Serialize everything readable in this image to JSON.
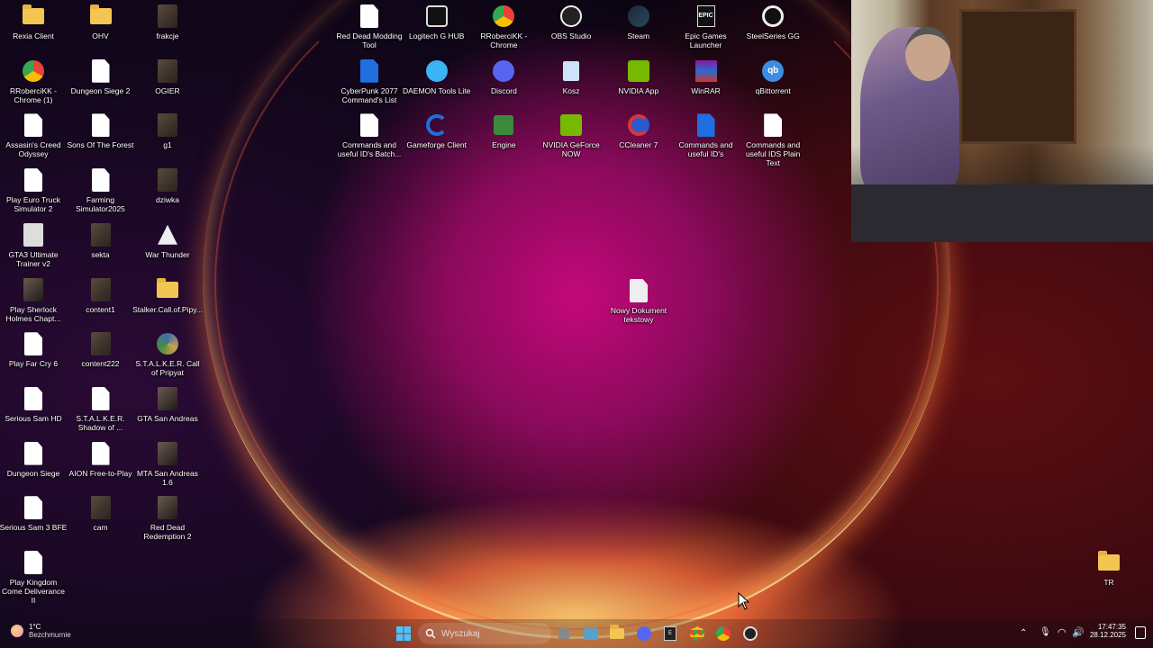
{
  "desktop": {
    "left_icons": [
      {
        "label": "Rexia Client",
        "icon": "folder-icon"
      },
      {
        "label": "OHV",
        "icon": "folder-icon"
      },
      {
        "label": "frakcje",
        "icon": "image-icon"
      },
      {
        "label": "RRoberciKK - Chrome (1)",
        "icon": "chrome-icon"
      },
      {
        "label": "Dungeon Siege 2",
        "icon": "document-icon"
      },
      {
        "label": "OGIER",
        "icon": "image-icon"
      },
      {
        "label": "Assasin's Creed Odyssey",
        "icon": "document-icon"
      },
      {
        "label": "Sons Of The Forest",
        "icon": "document-icon"
      },
      {
        "label": "g1",
        "icon": "image-icon"
      },
      {
        "label": "Play Euro Truck Simulator 2",
        "icon": "document-icon"
      },
      {
        "label": "Farming Simulator2025",
        "icon": "document-icon"
      },
      {
        "label": "dziwka",
        "icon": "image-icon"
      },
      {
        "label": "GTA3 Ultimate Trainer v2",
        "icon": "app-icon"
      },
      {
        "label": "sekta",
        "icon": "image-icon"
      },
      {
        "label": "War Thunder",
        "icon": "war-thunder-icon"
      },
      {
        "label": "Play Sherlock Holmes Chapt...",
        "icon": "game-icon"
      },
      {
        "label": "content1",
        "icon": "image-icon"
      },
      {
        "label": "Stalker.Call.of.Pipy...",
        "icon": "folder-icon"
      },
      {
        "label": "Play Far Cry 6",
        "icon": "document-icon"
      },
      {
        "label": "content222",
        "icon": "image-icon"
      },
      {
        "label": "S.T.A.L.K.E.R. Call of Pripyat",
        "icon": "stalker-icon"
      },
      {
        "label": "Serious Sam HD",
        "icon": "document-icon"
      },
      {
        "label": "S.T.A.L.K.E.R. Shadow of ...",
        "icon": "document-icon"
      },
      {
        "label": "GTA San Andreas",
        "icon": "game-icon"
      },
      {
        "label": "Dungeon Siege",
        "icon": "document-icon"
      },
      {
        "label": "AION Free-to-Play",
        "icon": "document-icon"
      },
      {
        "label": "MTA San Andreas 1.6",
        "icon": "game-icon"
      },
      {
        "label": "Serious Sam 3 BFE",
        "icon": "document-icon"
      },
      {
        "label": "cam",
        "icon": "image-icon"
      },
      {
        "label": "Red Dead Redemption 2",
        "icon": "game-icon"
      },
      {
        "label": "Play Kingdom Come Deliverance II",
        "icon": "document-icon"
      }
    ],
    "top_icons": [
      {
        "label": "Red Dead Modding Tool",
        "icon": "document-icon"
      },
      {
        "label": "Logitech G HUB",
        "icon": "logitech-icon"
      },
      {
        "label": "RRoberciKK - Chrome",
        "icon": "chrome-icon"
      },
      {
        "label": "OBS Studio",
        "icon": "obs-icon"
      },
      {
        "label": "Steam",
        "icon": "steam-icon"
      },
      {
        "label": "Epic Games Launcher",
        "icon": "epic-icon"
      },
      {
        "label": "SteelSeries GG",
        "icon": "steelseries-icon"
      },
      {
        "label": "CyberPunk 2077 Command's List",
        "icon": "word-doc-icon"
      },
      {
        "label": "DAEMON Tools Lite",
        "icon": "daemon-icon"
      },
      {
        "label": "Discord",
        "icon": "discord-icon"
      },
      {
        "label": "Kosz",
        "icon": "recycle-bin-icon"
      },
      {
        "label": "NVIDIA App",
        "icon": "nvidia-icon"
      },
      {
        "label": "WinRAR",
        "icon": "winrar-icon"
      },
      {
        "label": "qBittorrent",
        "icon": "qbittorrent-icon"
      },
      {
        "label": "Commands and useful ID's Batch...",
        "icon": "document-icon"
      },
      {
        "label": "Gameforge Client",
        "icon": "gameforge-icon"
      },
      {
        "label": "Engine",
        "icon": "engine-icon"
      },
      {
        "label": "NVIDIA GeForce NOW",
        "icon": "nvidia-icon"
      },
      {
        "label": "CCleaner 7",
        "icon": "ccleaner-icon"
      },
      {
        "label": "Commands and useful ID's",
        "icon": "word-doc-icon"
      },
      {
        "label": "Commands and useful IDS Plain Text",
        "icon": "document-icon"
      }
    ],
    "center_file": {
      "label": "Nowy Dokument tekstowy",
      "icon": "text-file-icon"
    },
    "right_folder": {
      "label": "TR",
      "icon": "folder-icon"
    }
  },
  "taskbar": {
    "weather": {
      "temp": "1°C",
      "condition": "Bezchmurnie"
    },
    "search_placeholder": "Wyszukaj",
    "pinned": [
      "task-view-icon",
      "widgets-icon",
      "file-explorer-icon",
      "discord-icon",
      "epic-icon",
      "chrome-icon",
      "chrome-profile-icon",
      "steelseries-icon"
    ],
    "time": "17:47:35",
    "date": "28.12.2025"
  },
  "colors": {
    "folder": "#f3c553",
    "accent": "#1a5fd0",
    "discord": "#5865f2",
    "nvidia": "#76b900"
  }
}
